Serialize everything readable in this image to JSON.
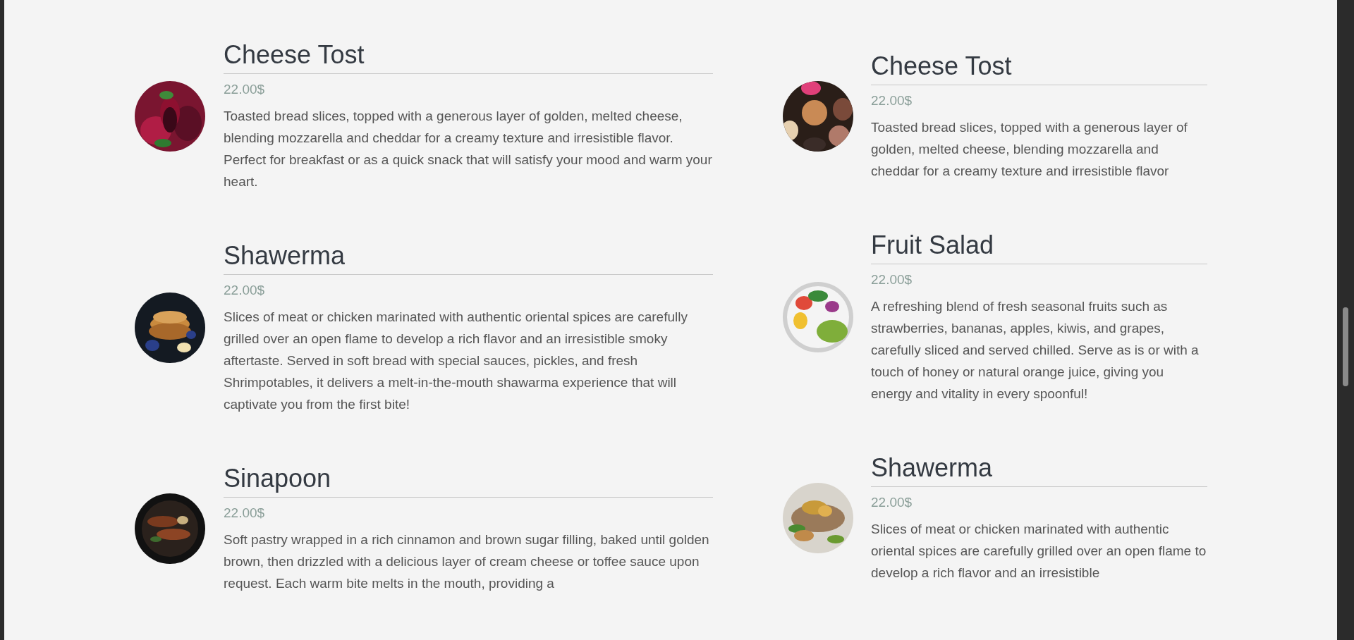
{
  "menu_columns": [
    {
      "items": [
        {
          "title": "Cheese Tost",
          "price": "22.00$",
          "description": "Toasted bread slices, topped with a generous layer of golden, melted cheese, blending mozzarella and cheddar for a creamy texture and irresistible flavor. Perfect for breakfast or as a quick snack that will satisfy your mood and warm your heart."
        },
        {
          "title": "Shawerma",
          "price": "22.00$",
          "description": "Slices of meat or chicken marinated with authentic oriental spices are carefully grilled over an open flame to develop a rich flavor and an irresistible smoky aftertaste. Served in soft bread with special sauces, pickles, and fresh Shrimpotables, it delivers a melt-in-the-mouth shawarma experience that will captivate you from the first bite!"
        },
        {
          "title": "Sinapoon",
          "price": "22.00$",
          "description": "Soft pastry wrapped in a rich cinnamon and brown sugar filling, baked until golden brown, then drizzled with a delicious layer of cream cheese or toffee sauce upon request. Each warm bite melts in the mouth, providing a"
        }
      ]
    },
    {
      "items": [
        {
          "title": "Cheese Tost",
          "price": "22.00$",
          "description": "Toasted bread slices, topped with a generous layer of golden, melted cheese, blending mozzarella and cheddar for a creamy texture and irresistible flavor"
        },
        {
          "title": "Fruit Salad",
          "price": "22.00$",
          "description": "A refreshing blend of fresh seasonal fruits such as strawberries, bananas, apples, kiwis, and grapes, carefully sliced and served chilled. Serve as is or with a touch of honey or natural orange juice, giving you energy and vitality in every spoonful!"
        },
        {
          "title": "Shawerma",
          "price": "22.00$",
          "description": "Slices of meat or chicken marinated with authentic oriental spices are carefully grilled over an open flame to develop a rich flavor and an irresistible"
        }
      ]
    }
  ]
}
